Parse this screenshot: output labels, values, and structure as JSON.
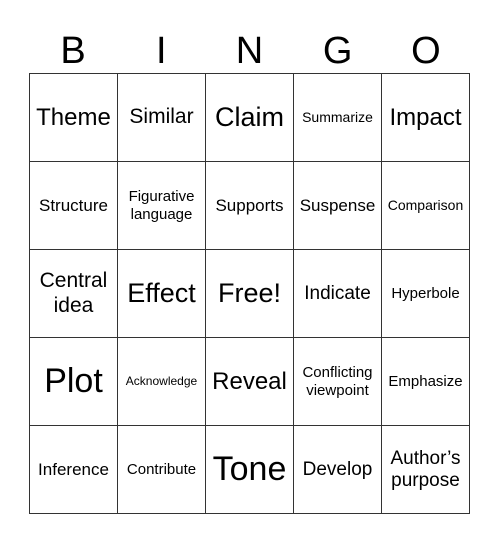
{
  "header": {
    "letters": [
      "B",
      "I",
      "N",
      "G",
      "O"
    ]
  },
  "grid": {
    "rows": [
      [
        "Theme",
        "Similar",
        "Claim",
        "Summarize",
        "Impact"
      ],
      [
        "Structure",
        "Figurative language",
        "Supports",
        "Suspense",
        "Comparison"
      ],
      [
        "Central idea",
        "Effect",
        "Free!",
        "Indicate",
        "Hyperbole"
      ],
      [
        "Plot",
        "Acknowledge",
        "Reveal",
        "Conflicting viewpoint",
        "Emphasize"
      ],
      [
        "Inference",
        "Contribute",
        "Tone",
        "Develop",
        "Author’s purpose"
      ]
    ]
  }
}
